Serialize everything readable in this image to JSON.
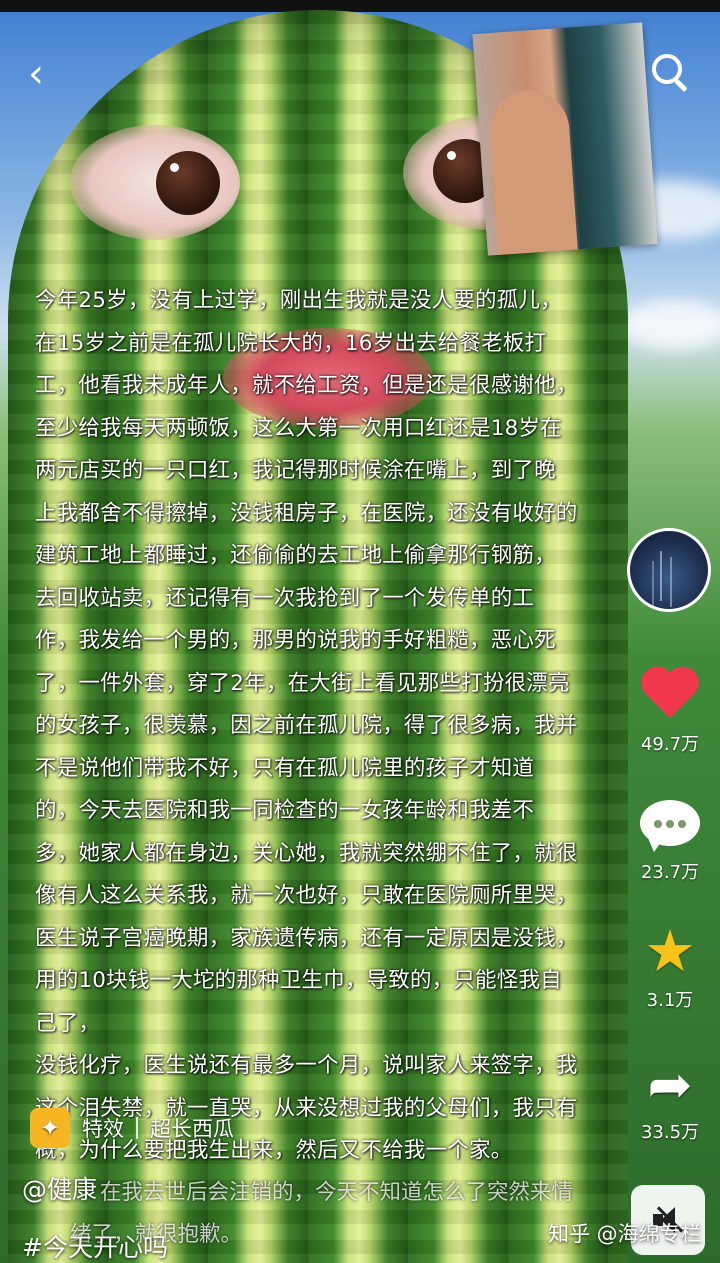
{
  "header": {
    "back_icon": "chevron-left-icon",
    "search_icon": "search-icon"
  },
  "story_lines": [
    "今年25岁，没有上过学，刚出生我就是没人要的孤儿，",
    "在15岁之前是在孤儿院长大的，16岁出去给餐老板打",
    "工，他看我未成年人，就不给工资，但是还是很感谢他，",
    "至少给我每天两顿饭，这么大第一次用口红还是18岁在",
    "两元店买的一只口红，我记得那时候涂在嘴上，到了晚",
    "上我都舍不得擦掉，没钱租房子，在医院，还没有收好的",
    "建筑工地上都睡过，还偷偷的去工地上偷拿那行钢筋，",
    "去回收站卖，还记得有一次我抢到了一个发传单的工",
    "作，我发给一个男的，那男的说我的手好粗糙，恶心死",
    "了，一件外套，穿了2年，在大街上看见那些打扮很漂亮",
    "的女孩子，很羡慕，因之前在孤儿院，得了很多病，我并",
    "不是说他们带我不好，只有在孤儿院里的孩子才知道",
    "的，今天去医院和我一同检查的一女孩年龄和我差不",
    "多，她家人都在身边，关心她，我就突然绷不住了，就很",
    "像有人这么关系我，就一次也好，只敢在医院厕所里哭，",
    "医生说子宫癌晚期，家族遗传病，还有一定原因是没钱，",
    "用的10块钱一大坨的那种卫生巾，导致的，只能怪我自",
    "己了，",
    "没钱化疗，医生说还有最多一个月，说叫家人来签字，我",
    "这个泪失禁，就一直哭，从来没想过我的父母们，我只有",
    "概，为什么要把我生出来，然后又不给我一个家。"
  ],
  "story_tail": [
    "在我去世后会注销的，今天不知道怎么了突然来情",
    "绪了，就很抱歉。"
  ],
  "sidebar": {
    "like_count": "49.7万",
    "comment_count": "23.7万",
    "favorite_count": "3.1万",
    "share_count": "33.5万"
  },
  "effect": {
    "label": "特效",
    "name": "超长西瓜"
  },
  "author": "@健康",
  "hashtag": "#今天开心吗",
  "watermark": "知乎 @海绵专栏",
  "colors": {
    "like": "#f2384c",
    "favorite": "#f7c21a",
    "effect_badge": "#f6b624"
  }
}
